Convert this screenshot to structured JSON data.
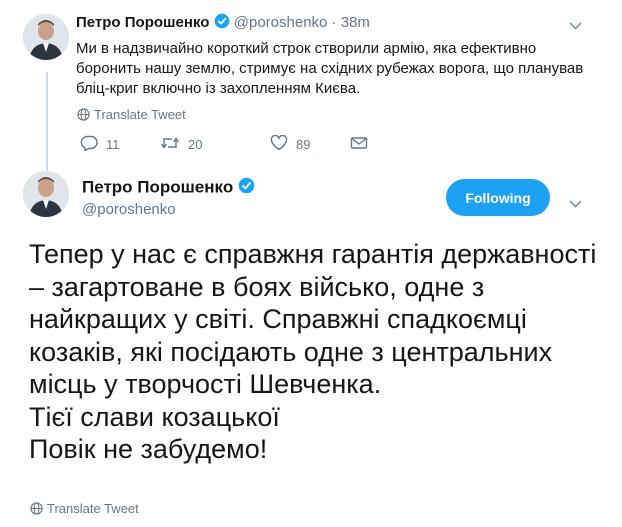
{
  "tweet1": {
    "author_name": "Петро Порошенко",
    "handle": "@poroshenko",
    "separator": "·",
    "time": "38m",
    "text": "Ми в надзвичайно короткий строк створили армію, яка ефективно боронить нашу землю, стримує на східних рубежах ворога, що планував бліц-криг включно із захопленням Києва.",
    "translate_label": "Translate Tweet",
    "reply_count": "11",
    "retweet_count": "20",
    "like_count": "89"
  },
  "tweet2": {
    "author_name": "Петро Порошенко",
    "handle": "@poroshenko",
    "follow_label": "Following",
    "text": "Тепер у нас є справжня гарантія державності – загартоване в боях військо, одне з найкращих у світі. Справжні спадкоємці козаків, які посідають одне з центральних місць у творчості Шевченка.\nТієї слави козацької\nПовік не забудемо!",
    "translate_label": "Translate Tweet"
  },
  "colors": {
    "accent": "#1da1f2",
    "muted": "#657786",
    "thread_line": "#c4dbe8"
  },
  "icons": [
    "verified-badge-icon",
    "globe-icon",
    "reply-icon",
    "retweet-icon",
    "like-icon",
    "dm-icon",
    "chevron-down-icon"
  ]
}
